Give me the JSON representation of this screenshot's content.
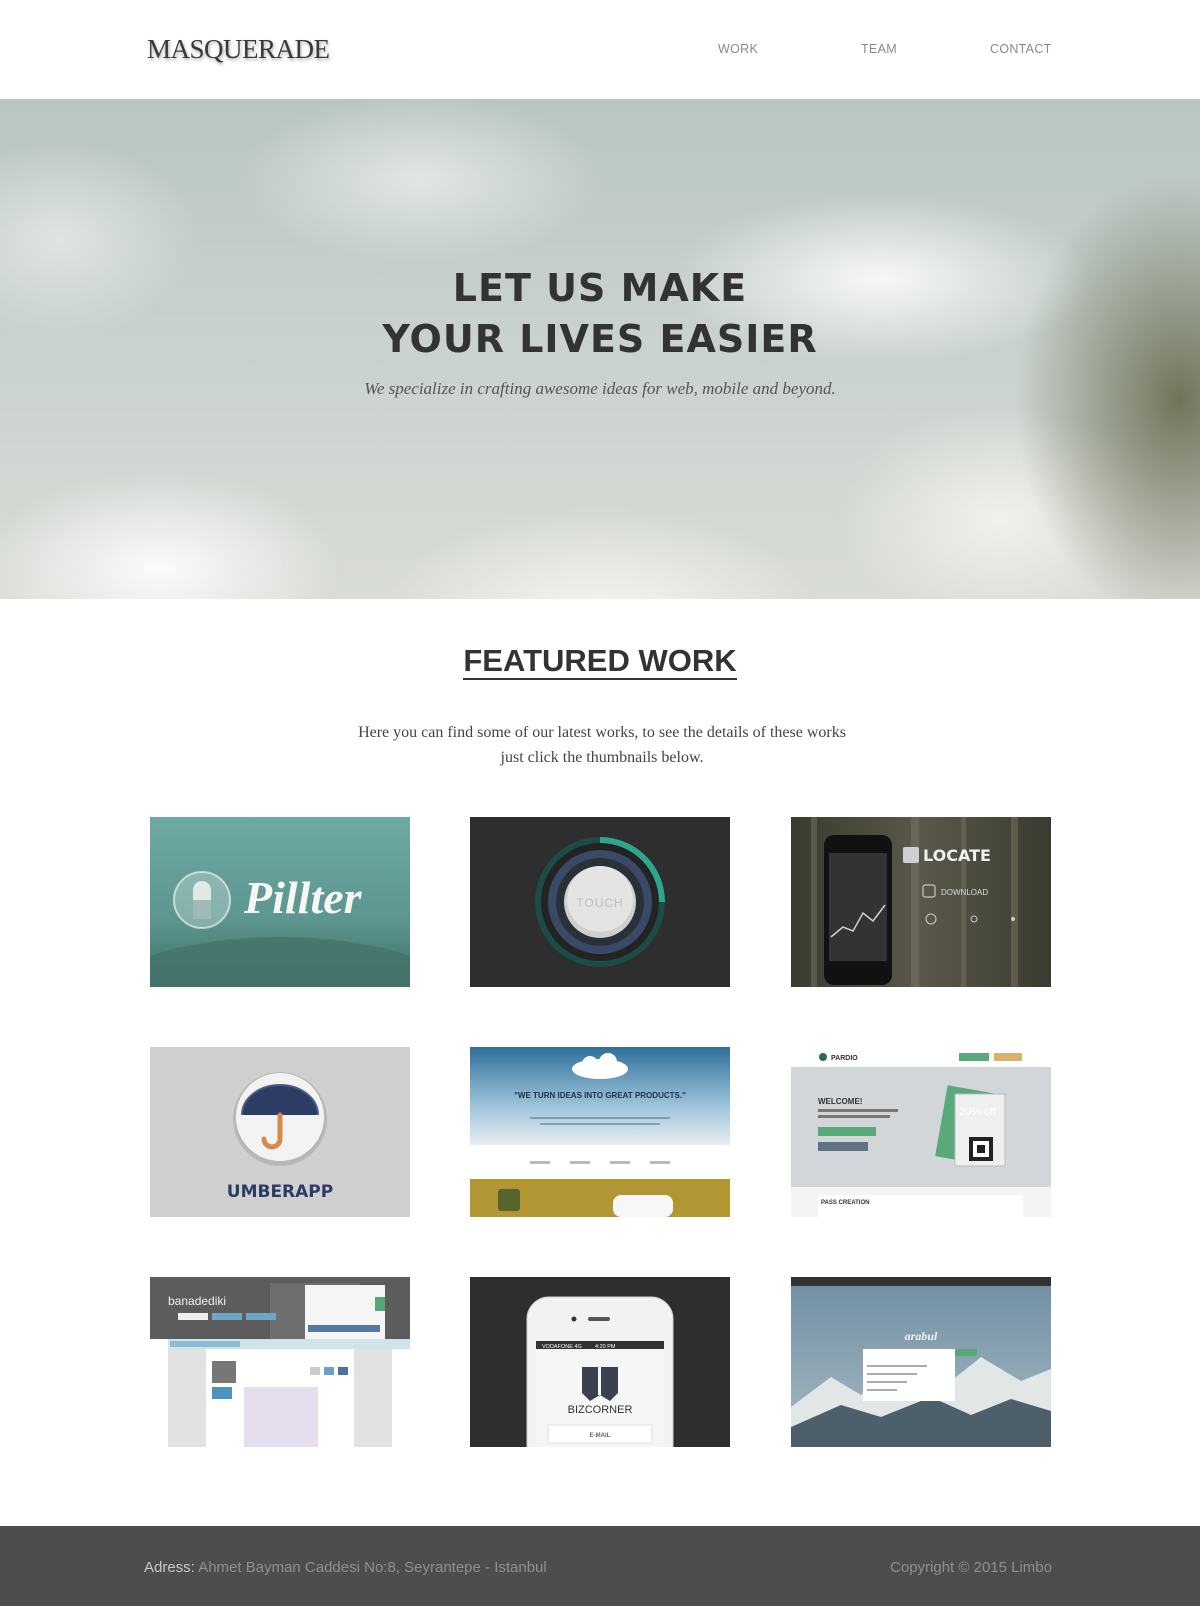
{
  "header": {
    "logo": "MASQUERADE",
    "nav": [
      {
        "label": "WORK"
      },
      {
        "label": "TEAM"
      },
      {
        "label": "CONTACT"
      }
    ]
  },
  "hero": {
    "title_line1": "LET US MAKE",
    "title_line2": "YOUR LIVES EASIER",
    "subtitle": "We specialize in crafting awesome ideas for web, mobile and beyond."
  },
  "featured": {
    "title": "FEATURED WORK",
    "intro_line1": "Here you can find some of our latest works, to see the details of these works",
    "intro_line2": "just click the thumbnails below."
  },
  "thumbs": {
    "pillter": {
      "text": "Pillter"
    },
    "touch": {
      "text": "TOUCH"
    },
    "locate": {
      "title": "LOCATE",
      "sub": "DOWNLOAD"
    },
    "umberapp": {
      "text": "UMBERAPP"
    },
    "ideas": {
      "quote": "\"WE TURN IDEAS INTO GREAT PRODUCTS.\""
    },
    "pardio": {
      "brand": "PARDIO",
      "welcome": "WELCOME!",
      "sub": "PASSBOOK, THE FASTEST WAY TO BUILD YOUR OWN PASSES",
      "pass": "PASS CREATION",
      "offer": "20% off"
    },
    "banadediki": {
      "brand": "banadediki"
    },
    "bizcorner": {
      "brand": "BIZCORNER",
      "carrier": "VODAFONE 4G",
      "time": "4:20 PM",
      "email": "E-MAIL"
    },
    "arabul": {
      "brand": "arabul"
    }
  },
  "footer": {
    "address_label": "Adress:",
    "address_value": "Ahmet Bayman Caddesi No:8, Seyrantepe - Istanbul",
    "copyright": "Copyright © 2015 Limbo"
  },
  "colors": {
    "footer_bg": "#4d4d4d",
    "text_dark": "#333333",
    "nav_text": "#8a8a8a"
  }
}
